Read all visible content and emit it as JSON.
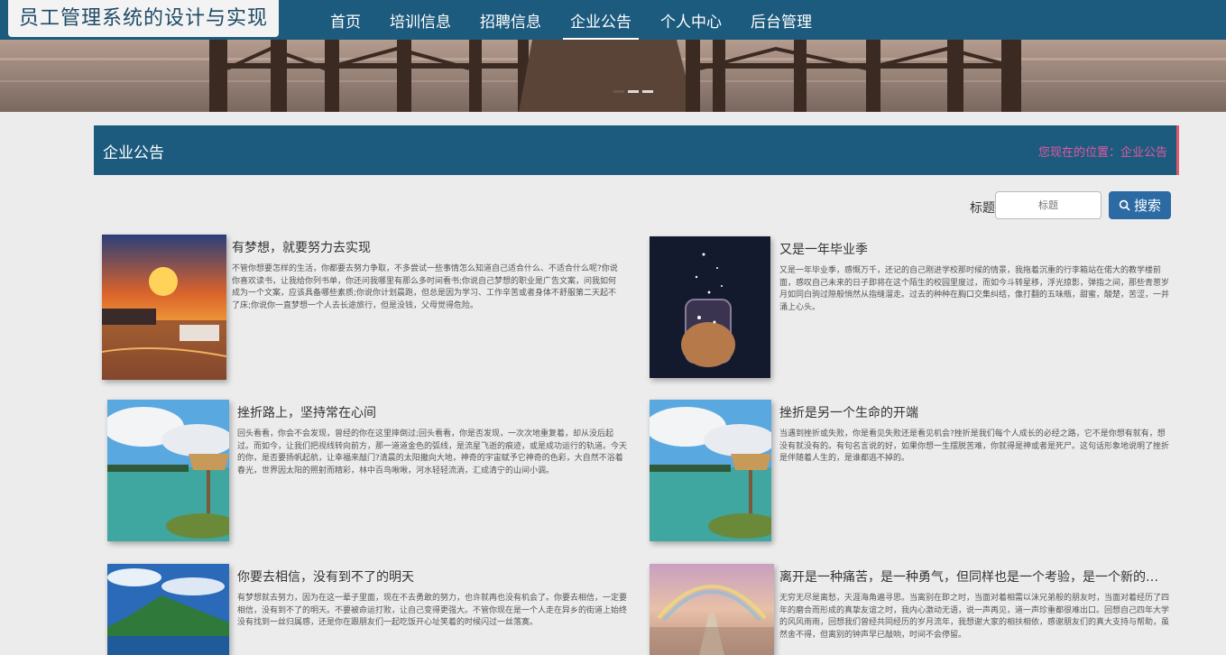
{
  "nav": {
    "logo": "员工管理系统的设计与实现",
    "items": [
      "首页",
      "培训信息",
      "招聘信息",
      "企业公告",
      "个人中心",
      "后台管理"
    ],
    "active_index": 3
  },
  "section": {
    "title": "企业公告",
    "location": "您现在的位置：企业公告"
  },
  "search": {
    "label": "标题",
    "placeholder": "标题",
    "button": "搜索"
  },
  "cards": [
    {
      "title": "有梦想，就要努力去实现",
      "desc": "不管你想要怎样的生活，你都要去努力争取，不多尝试一些事情怎么知道自己适合什么、不适合什么呢?你说你喜欢读书，让我给你列书单，你还问我哪里有那么多时间看书;你说自己梦想的职业是广告文案，问我如何成为一个文案，应该具备哪些素质;你说你计划晨跑，但总是因为学习、工作辛苦或者身体不舒服第二天起不了床;你说你一直梦想一个人去长途旅行，但是没钱，父母觉得危险。"
    },
    {
      "title": "又是一年毕业季",
      "desc": "又是一年毕业季，感慨万千，还记的自己刚进学校那时候的情景，我拖着沉重的行李箱站在偌大的教学楼前面，感叹自己未来的日子即将在这个陌生的校园里度过，而如今斗转星移，浮光掠影，弹指之间，那些青葱岁月如同白驹过隙般悄然从指缝溜走。过去的种种在胸口交集纠结，像打翻的五味瓶，甜蜜，酸楚，苦涩，一并涌上心头。"
    },
    {
      "title": "挫折路上，坚持常在心间",
      "desc": "回头看看，你会不会发现，曾经的你在这里摔倒过;回头看看，你是否发现，一次次地重复着，却从没后起过。而如今，让我们把视线转向前方，那一道道金色的弧线，是流星飞逝的痕迹，或是成功运行的轨道。今天的你，是否要扬帆起航，让幸福来敲门?清晨的太阳撒向大地，神奇的宇宙赋予它神奇的色彩，大自然不浴着春光，世界因太阳的照射而精彩，林中百鸟啾啾，河水轻轻流淌，汇成清宁的山间小调。"
    },
    {
      "title": "挫折是另一个生命的开端",
      "desc": "当遇到挫折或失败，你是看见失败还是看见机会?挫折是我们每个人成长的必经之路，它不是你想有就有，想没有就没有的。有句名言说的好，如果你想一生摆脱苦难，你就得是神或者是死尸。这句话形象地说明了挫折是伴随着人生的，是谁都逃不掉的。"
    },
    {
      "title": "你要去相信，没有到不了的明天",
      "desc": "有梦想就去努力，因为在这一辈子里面，现在不去勇敢的努力，也许就再也没有机会了。你要去相信，一定要相信，没有到不了的明天。不要被命运打败，让自己变得更强大。不管你现在是一个人走在异乡的街道上始终没有找到一丝归属感，还是你在跟朋友们一起吃饭开心址笑着的时候闪过一丝落寞。"
    },
    {
      "title": "离开是一种痛苦，是一种勇气，但同样也是一个考验，是一个新的开始",
      "desc": "无穷无尽是离愁，天涯海角遍寻思。当离别在即之时，当面对着相需以沫兄弟般的朋友时，当面对着经历了四年的磨合而形成的真挚友谊之时，我内心激动无语，说一声再见，道一声珍重都很难出口。回想自己四年大学的风风雨雨，回想我们曾经共同经历的岁月流年，我想谢大家的相扶相依，感谢朋友们的真大支持与帮助，虽然舍不得，但离别的钟声早已敲响，时间不会停留。"
    }
  ]
}
